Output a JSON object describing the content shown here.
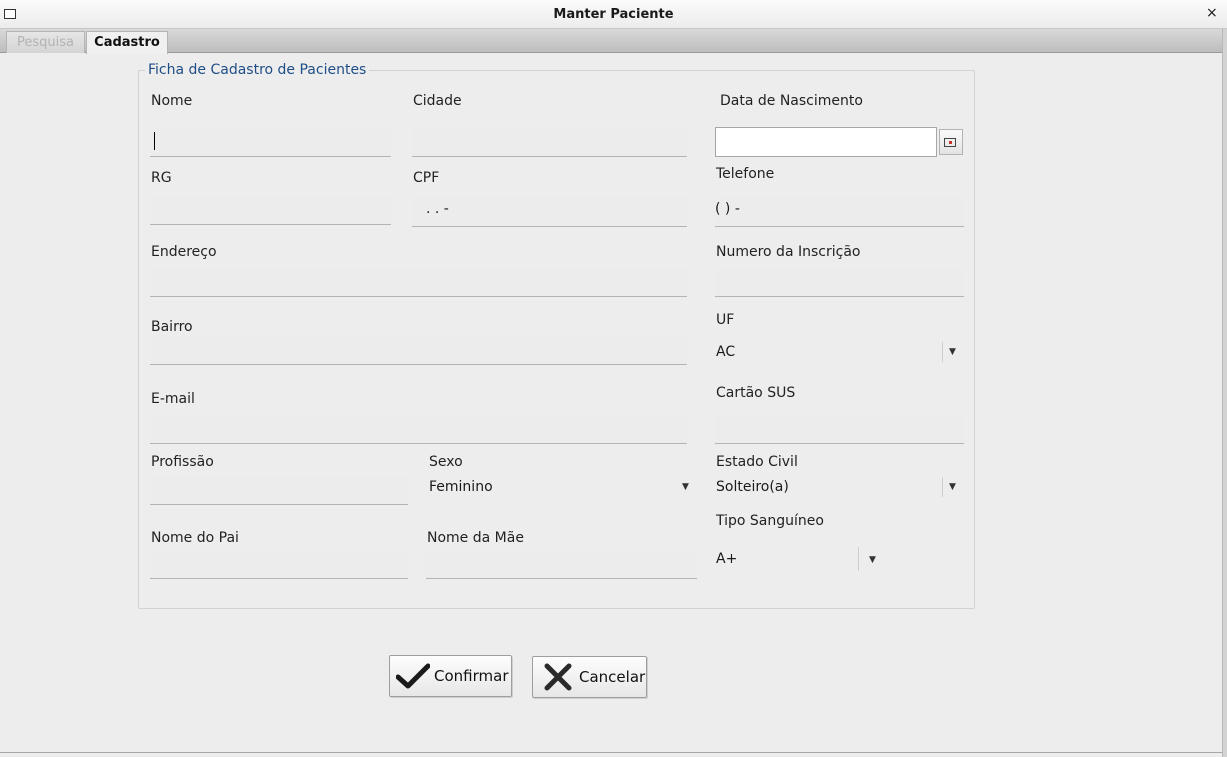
{
  "window": {
    "title": "Manter Paciente",
    "close_glyph": "×"
  },
  "tabs": [
    {
      "label": "Pesquisa",
      "active": false
    },
    {
      "label": "Cadastro",
      "active": true
    }
  ],
  "form": {
    "legend": "Ficha de Cadastro de Pacientes",
    "fields": {
      "nome": {
        "label": "Nome",
        "value": ""
      },
      "cidade": {
        "label": "Cidade",
        "value": ""
      },
      "data_nascimento": {
        "label": "Data de Nascimento",
        "value": "",
        "button_icon": "calendar-icon"
      },
      "rg": {
        "label": "RG",
        "value": ""
      },
      "cpf": {
        "label": "CPF",
        "value": ".   .   -"
      },
      "telefone": {
        "label": "Telefone",
        "value": "(  )      -"
      },
      "endereco": {
        "label": "Endereço",
        "value": ""
      },
      "numero_inscricao": {
        "label": "Numero da Inscrição",
        "value": ""
      },
      "bairro": {
        "label": "Bairro",
        "value": ""
      },
      "uf": {
        "label": "UF",
        "value": "AC"
      },
      "email": {
        "label": "E-mail",
        "value": ""
      },
      "cartao_sus": {
        "label": "Cartão SUS",
        "value": ""
      },
      "profissao": {
        "label": "Profissão",
        "value": ""
      },
      "sexo": {
        "label": "Sexo",
        "value": "Feminino"
      },
      "estado_civil": {
        "label": "Estado Civil",
        "value": "Solteiro(a)"
      },
      "tipo_sanguineo": {
        "label": "Tipo Sanguíneo",
        "value": "A+"
      },
      "nome_pai": {
        "label": "Nome do Pai",
        "value": ""
      },
      "nome_mae": {
        "label": "Nome da Mãe",
        "value": ""
      }
    },
    "dropdown_arrow": "▼"
  },
  "buttons": {
    "confirm": {
      "label": "Confirmar",
      "icon": "checkmark-icon",
      "color": "#1a1a1a"
    },
    "cancel": {
      "label": "Cancelar",
      "icon": "cross-icon",
      "color": "#1a1a1a"
    }
  }
}
